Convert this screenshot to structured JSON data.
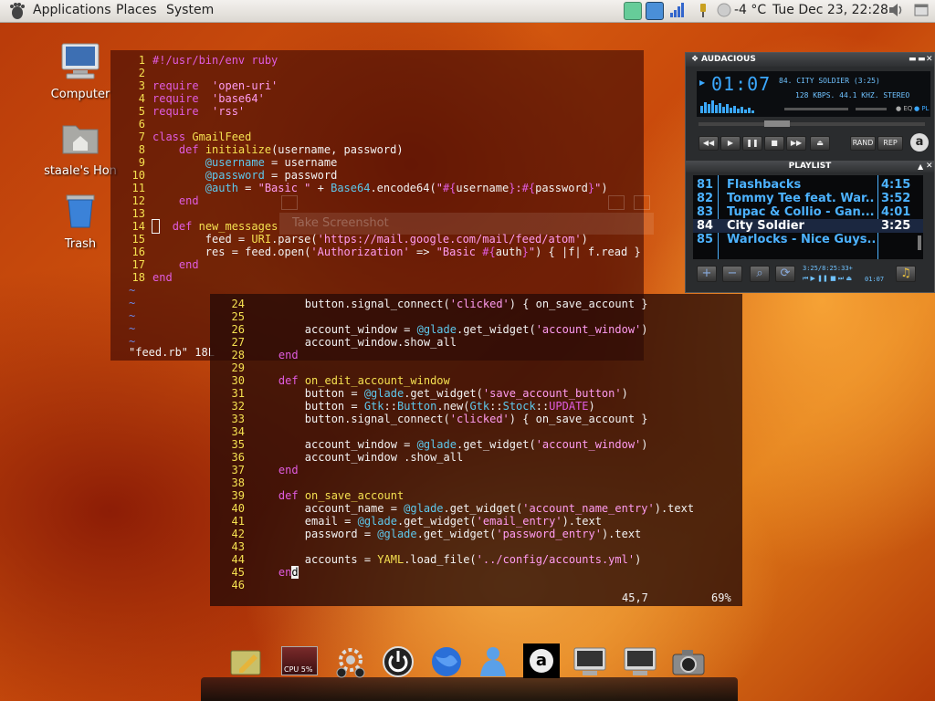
{
  "panel": {
    "menus": [
      "Applications",
      "Places",
      "System"
    ],
    "weather": "-4 °C",
    "clock": "Tue Dec 23, 22:28"
  },
  "desktop": {
    "icons": [
      {
        "label": "Computer",
        "icon": "computer-icon"
      },
      {
        "label": "staale's Hon",
        "icon": "home-folder-icon"
      },
      {
        "label": "Trash",
        "icon": "trash-icon"
      }
    ]
  },
  "terminal1": {
    "lines": [
      {
        "n": "1",
        "t": [
          [
            "kw",
            "#!/usr/bin/env ruby"
          ]
        ]
      },
      {
        "n": "2",
        "t": []
      },
      {
        "n": "3",
        "t": [
          [
            "kw",
            "require"
          ],
          [
            "",
            "  "
          ],
          [
            "str",
            "'open-uri'"
          ]
        ]
      },
      {
        "n": "4",
        "t": [
          [
            "kw",
            "require"
          ],
          [
            "",
            "  "
          ],
          [
            "str",
            "'base64'"
          ]
        ]
      },
      {
        "n": "5",
        "t": [
          [
            "kw",
            "require"
          ],
          [
            "",
            "  "
          ],
          [
            "str",
            "'rss'"
          ]
        ]
      },
      {
        "n": "6",
        "t": []
      },
      {
        "n": "7",
        "t": [
          [
            "kw",
            "class "
          ],
          [
            "const",
            "GmailFeed"
          ]
        ]
      },
      {
        "n": "8",
        "t": [
          [
            "",
            "    "
          ],
          [
            "kw",
            "def "
          ],
          [
            "const",
            "initialize"
          ],
          [
            "",
            "(username, password)"
          ]
        ]
      },
      {
        "n": "9",
        "t": [
          [
            "",
            "        "
          ],
          [
            "ivar",
            "@username"
          ],
          [
            "",
            " = username"
          ]
        ]
      },
      {
        "n": "10",
        "t": [
          [
            "",
            "        "
          ],
          [
            "ivar",
            "@password"
          ],
          [
            "",
            " = password"
          ]
        ]
      },
      {
        "n": "11",
        "t": [
          [
            "",
            "        "
          ],
          [
            "ivar",
            "@auth"
          ],
          [
            "",
            " = "
          ],
          [
            "str",
            "\"Basic \""
          ],
          [
            "",
            " + "
          ],
          [
            "ivar",
            "Base64"
          ],
          [
            "",
            ".encode64("
          ],
          [
            "str",
            "\""
          ],
          [
            "interp",
            "#{"
          ],
          [
            "",
            "username"
          ],
          [
            "interp",
            "}"
          ],
          [
            "str",
            ":"
          ],
          [
            "interp",
            "#{"
          ],
          [
            "",
            "password"
          ],
          [
            "interp",
            "}"
          ],
          [
            "str",
            "\""
          ],
          [
            "",
            ")"
          ]
        ]
      },
      {
        "n": "12",
        "t": [
          [
            "",
            "    "
          ],
          [
            "kw",
            "end"
          ]
        ]
      },
      {
        "n": "13",
        "t": []
      },
      {
        "n": "14",
        "t": [
          [
            "cursorbox",
            " "
          ],
          [
            "",
            "  "
          ],
          [
            "kw",
            "def "
          ],
          [
            "const",
            "new_messages"
          ]
        ]
      },
      {
        "n": "15",
        "t": [
          [
            "",
            "        feed = "
          ],
          [
            "const",
            "URI"
          ],
          [
            "",
            ".parse("
          ],
          [
            "str",
            "'https://mail.google.com/mail/feed/atom'"
          ],
          [
            "",
            ")"
          ]
        ]
      },
      {
        "n": "16",
        "t": [
          [
            "",
            "        res = feed.open("
          ],
          [
            "str",
            "'Authorization'"
          ],
          [
            "",
            " => "
          ],
          [
            "str",
            "\"Basic "
          ],
          [
            "interp",
            "#{"
          ],
          [
            "",
            "auth"
          ],
          [
            "interp",
            "}"
          ],
          [
            "str",
            "\""
          ],
          [
            "",
            ") { |f| f.read }"
          ]
        ]
      },
      {
        "n": "17",
        "t": [
          [
            "",
            "    "
          ],
          [
            "kw",
            "end"
          ]
        ]
      },
      {
        "n": "18",
        "t": [
          [
            "kw",
            "end"
          ]
        ]
      }
    ],
    "tildes": 5,
    "status": "\"feed.rb\" 18L"
  },
  "terminal2": {
    "lines": [
      {
        "n": "24",
        "t": [
          [
            "",
            "        button.signal_connect("
          ],
          [
            "str",
            "'clicked'"
          ],
          [
            "",
            ") { on_save_account }"
          ]
        ]
      },
      {
        "n": "25",
        "t": []
      },
      {
        "n": "26",
        "t": [
          [
            "",
            "        account_window = "
          ],
          [
            "ivar",
            "@glade"
          ],
          [
            "",
            ".get_widget("
          ],
          [
            "str",
            "'account_window'"
          ],
          [
            "",
            ")"
          ]
        ]
      },
      {
        "n": "27",
        "t": [
          [
            "",
            "        account_window.show_all"
          ]
        ]
      },
      {
        "n": "28",
        "t": [
          [
            "",
            "    "
          ],
          [
            "kw",
            "end"
          ]
        ]
      },
      {
        "n": "29",
        "t": []
      },
      {
        "n": "30",
        "t": [
          [
            "",
            "    "
          ],
          [
            "kw",
            "def "
          ],
          [
            "const",
            "on_edit_account_window"
          ]
        ]
      },
      {
        "n": "31",
        "t": [
          [
            "",
            "        button = "
          ],
          [
            "ivar",
            "@glade"
          ],
          [
            "",
            ".get_widget("
          ],
          [
            "str",
            "'save_account_button'"
          ],
          [
            "",
            ")"
          ]
        ]
      },
      {
        "n": "32",
        "t": [
          [
            "",
            "        button = "
          ],
          [
            "ivar",
            "Gtk"
          ],
          [
            "",
            "::"
          ],
          [
            "ivar",
            "Button"
          ],
          [
            "",
            ".new("
          ],
          [
            "ivar",
            "Gtk"
          ],
          [
            "",
            "::"
          ],
          [
            "ivar",
            "Stock"
          ],
          [
            "",
            "::"
          ],
          [
            "kw",
            "UPDATE"
          ],
          [
            "",
            ")"
          ]
        ]
      },
      {
        "n": "33",
        "t": [
          [
            "",
            "        button.signal_connect("
          ],
          [
            "str",
            "'clicked'"
          ],
          [
            "",
            ") { on_save_account }"
          ]
        ]
      },
      {
        "n": "34",
        "t": []
      },
      {
        "n": "35",
        "t": [
          [
            "",
            "        account_window = "
          ],
          [
            "ivar",
            "@glade"
          ],
          [
            "",
            ".get_widget("
          ],
          [
            "str",
            "'account_window'"
          ],
          [
            "",
            ")"
          ]
        ]
      },
      {
        "n": "36",
        "t": [
          [
            "",
            "        account_window .show_all"
          ]
        ]
      },
      {
        "n": "37",
        "t": [
          [
            "",
            "    "
          ],
          [
            "kw",
            "end"
          ]
        ]
      },
      {
        "n": "38",
        "t": []
      },
      {
        "n": "39",
        "t": [
          [
            "",
            "    "
          ],
          [
            "kw",
            "def "
          ],
          [
            "const",
            "on_save_account"
          ]
        ]
      },
      {
        "n": "40",
        "t": [
          [
            "",
            "        account_name = "
          ],
          [
            "ivar",
            "@glade"
          ],
          [
            "",
            ".get_widget("
          ],
          [
            "str",
            "'account_name_entry'"
          ],
          [
            "",
            ").text"
          ]
        ]
      },
      {
        "n": "41",
        "t": [
          [
            "",
            "        email = "
          ],
          [
            "ivar",
            "@glade"
          ],
          [
            "",
            ".get_widget("
          ],
          [
            "str",
            "'email_entry'"
          ],
          [
            "",
            ").text"
          ]
        ]
      },
      {
        "n": "42",
        "t": [
          [
            "",
            "        password = "
          ],
          [
            "ivar",
            "@glade"
          ],
          [
            "",
            ".get_widget("
          ],
          [
            "str",
            "'password_entry'"
          ],
          [
            "",
            ").text"
          ]
        ]
      },
      {
        "n": "43",
        "t": []
      },
      {
        "n": "44",
        "t": [
          [
            "",
            "        accounts = "
          ],
          [
            "const",
            "YAML"
          ],
          [
            "",
            ".load_file("
          ],
          [
            "str",
            "'../config/accounts.yml'"
          ],
          [
            "",
            ")"
          ]
        ]
      },
      {
        "n": "45",
        "t": [
          [
            "",
            "    "
          ],
          [
            "kw",
            "en"
          ],
          [
            "cursor",
            "d"
          ]
        ]
      },
      {
        "n": "46",
        "t": []
      }
    ],
    "position": "45,7",
    "percent": "69%"
  },
  "dialog_ghost": {
    "title": "Take Screenshot"
  },
  "audacious": {
    "title": "AUDACIOUS",
    "time": "01:07",
    "song": "84. CITY SOLDIER (3:25)",
    "info": "128 KBPS. 44.1 KHZ. STEREO",
    "buttons": {
      "rand": "RAND",
      "rep": "REP"
    },
    "playlist_title": "PLAYLIST",
    "playlist": [
      {
        "num": "81",
        "title": "Flashbacks",
        "dur": "4:15"
      },
      {
        "num": "82",
        "title": "Tommy Tee feat. War...",
        "dur": "3:52"
      },
      {
        "num": "83",
        "title": "Tupac & Collio - Gan...",
        "dur": "4:01"
      },
      {
        "num": "84",
        "title": "City Soldier",
        "dur": "3:25"
      },
      {
        "num": "85",
        "title": "Warlocks - Nice Guys...",
        "dur": ""
      }
    ],
    "current_index": 3,
    "pl_time": "3:25/8:25:33+",
    "mini_time": "01:07"
  },
  "dock": {
    "cpu_label": "CPU 5%",
    "items": [
      "notes-icon",
      "cpu-monitor-icon",
      "system-settings-icon",
      "power-icon",
      "globe-icon",
      "contact-icon",
      "audacious-icon",
      "terminal-icon",
      "terminal-icon",
      "camera-icon"
    ]
  }
}
